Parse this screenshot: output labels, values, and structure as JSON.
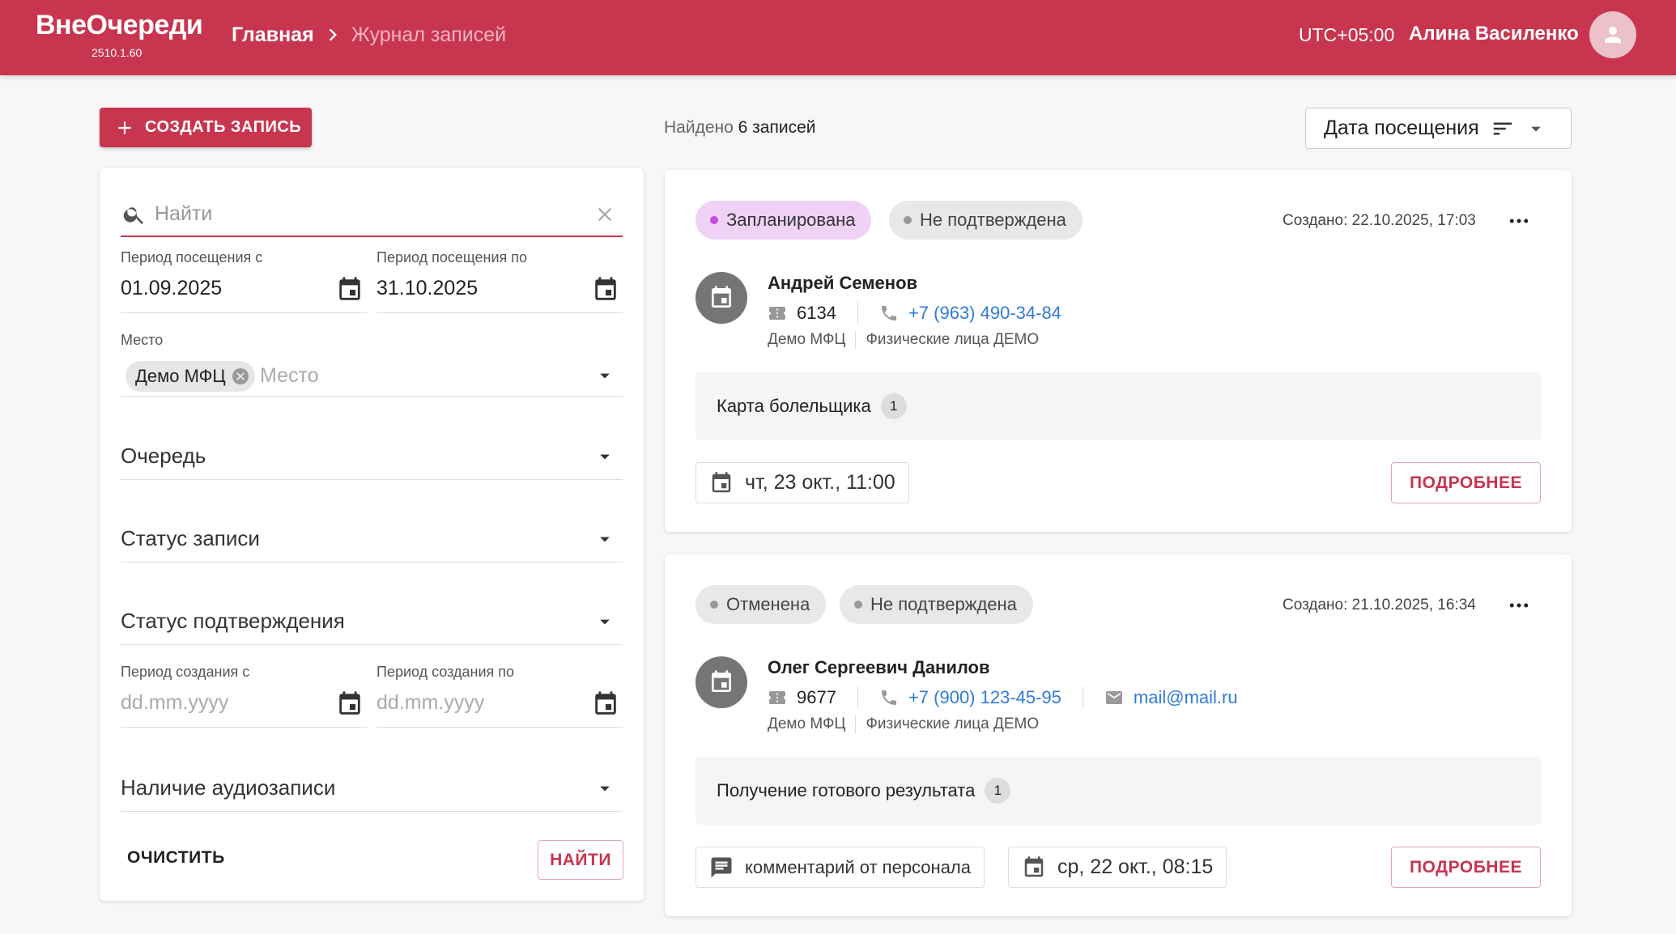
{
  "header": {
    "logo": "ВнеОчереди",
    "version": "2510.1.60",
    "breadcrumb_home": "Главная",
    "breadcrumb_current": "Журнал записей",
    "timezone": "UTC+05:00",
    "user_name": "Алина Василенко"
  },
  "toolbar": {
    "create_label": "СОЗДАТЬ ЗАПИСЬ",
    "found_prefix": "Найдено",
    "found_count": "6 записей",
    "sort_label": "Дата посещения"
  },
  "filters": {
    "search_placeholder": "Найти",
    "visit_from_label": "Период посещения с",
    "visit_from_value": "01.09.2025",
    "visit_to_label": "Период посещения по",
    "visit_to_value": "31.10.2025",
    "place_label": "Место",
    "place_chip": "Демо МФЦ",
    "place_placeholder": "Место",
    "queue_label": "Очередь",
    "status_label": "Статус записи",
    "confirm_label": "Статус подтверждения",
    "created_from_label": "Период создания с",
    "created_from_placeholder": "dd.mm.yyyy",
    "created_to_label": "Период создания по",
    "created_to_placeholder": "dd.mm.yyyy",
    "audio_label": "Наличие аудиозаписи",
    "clear_label": "ОЧИСТИТЬ",
    "find_label": "НАЙТИ"
  },
  "cards": [
    {
      "status": "Запланирована",
      "confirmation": "Не подтверждена",
      "created": "Создано: 22.10.2025, 17:03",
      "name": "Андрей Семенов",
      "ticket": "6134",
      "phone": "+7 (963) 490-34-84",
      "office": "Демо МФЦ",
      "queue": "Физические лица ДЕМО",
      "service": "Карта болельщика",
      "service_count": "1",
      "datetime": "чт, 23 окт., 11:00",
      "details_label": "ПОДРОБНЕЕ"
    },
    {
      "status": "Отменена",
      "confirmation": "Не подтверждена",
      "created": "Создано: 21.10.2025, 16:34",
      "name": "Олег Сергеевич Данилов",
      "ticket": "9677",
      "phone": "+7 (900) 123-45-95",
      "email": "mail@mail.ru",
      "office": "Демо МФЦ",
      "queue": "Физические лица ДЕМО",
      "service": "Получение готового результата",
      "service_count": "1",
      "comment": "комментарий от персонала",
      "datetime": "ср, 22 окт., 08:15",
      "details_label": "ПОДРОБНЕЕ"
    }
  ],
  "colors": {
    "brand": "#c8354f",
    "planned_badge": "#f0d2f7",
    "link": "#2f7bd6"
  }
}
